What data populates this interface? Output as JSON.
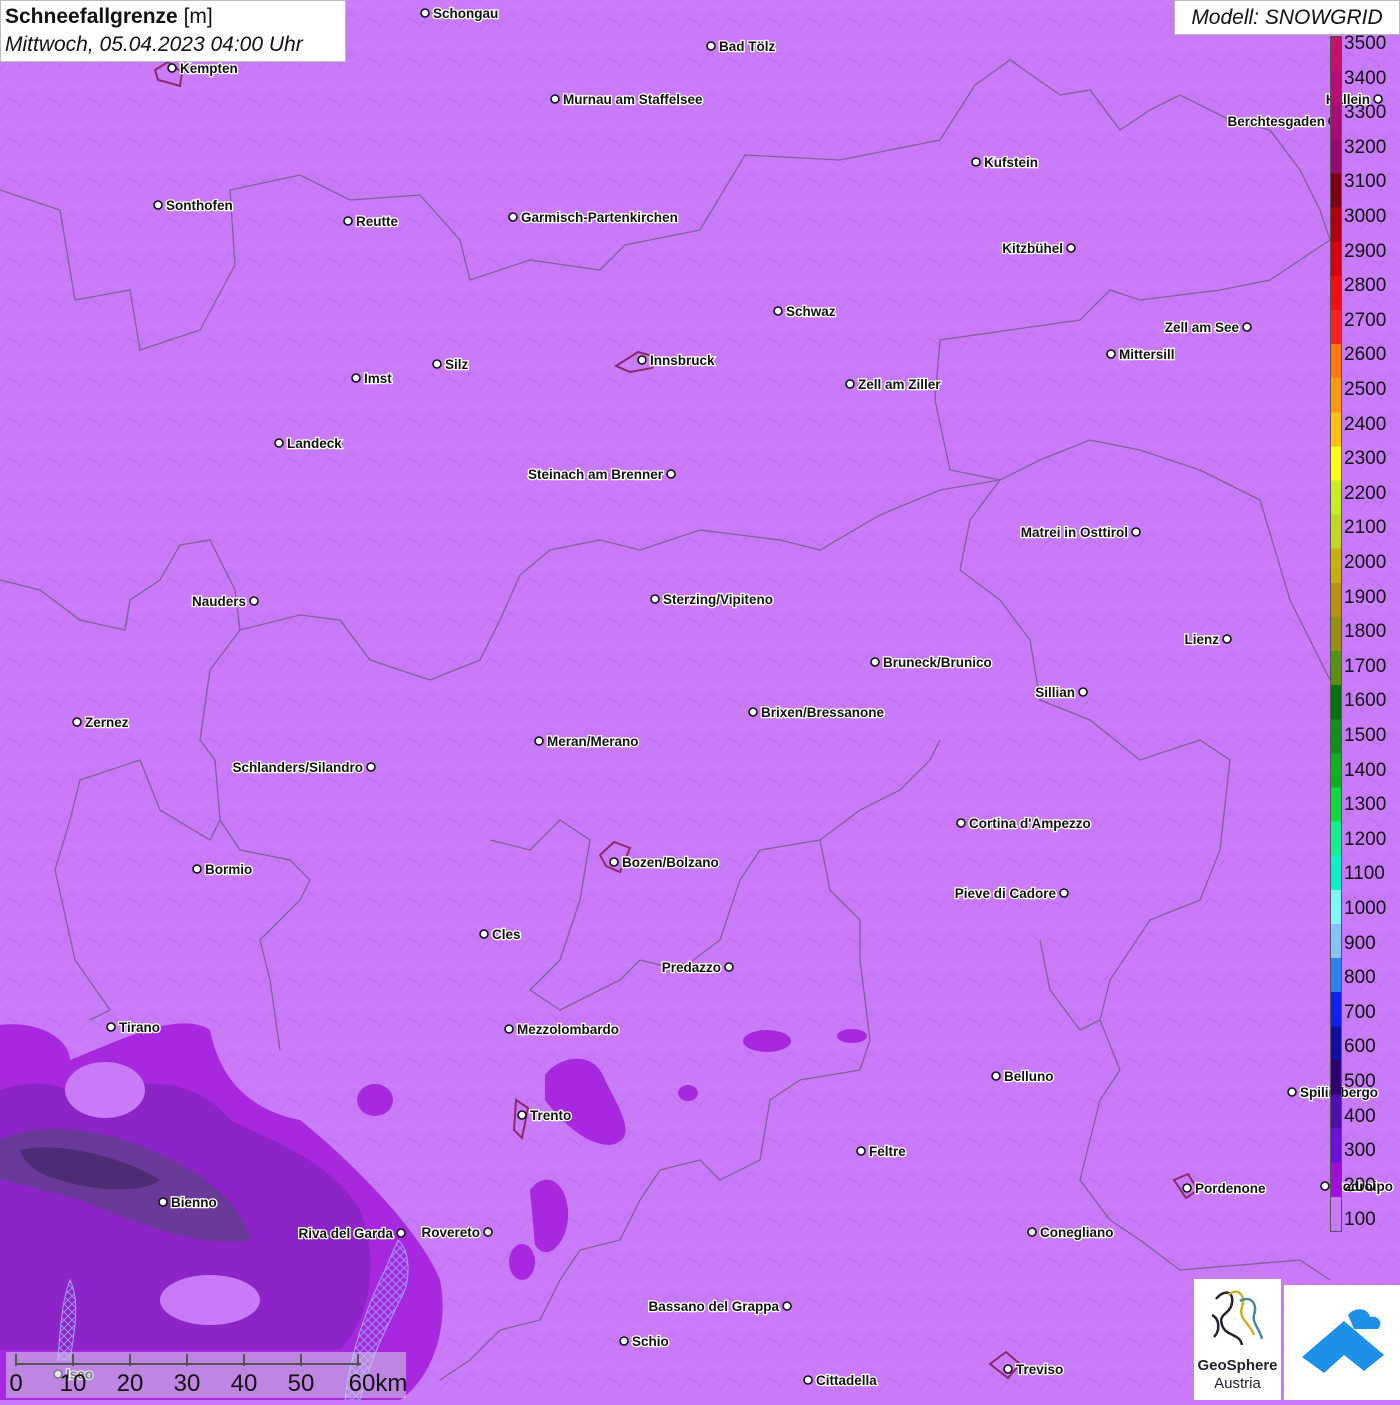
{
  "title": {
    "name": "Schneefallgrenze",
    "unit": "[m]",
    "datetime": "Mittwoch, 05.04.2023 04:00 Uhr"
  },
  "model": "Modell: SNOWGRID",
  "legend": {
    "levels": [
      {
        "value": "3500",
        "color": "#c8106e"
      },
      {
        "value": "3400",
        "color": "#b80e72"
      },
      {
        "value": "3300",
        "color": "#a80c76"
      },
      {
        "value": "3200",
        "color": "#960a6a"
      },
      {
        "value": "3100",
        "color": "#7a0010"
      },
      {
        "value": "3000",
        "color": "#b00010"
      },
      {
        "value": "2900",
        "color": "#d80010"
      },
      {
        "value": "2800",
        "color": "#f01010"
      },
      {
        "value": "2700",
        "color": "#ff2020"
      },
      {
        "value": "2600",
        "color": "#ff7a10"
      },
      {
        "value": "2500",
        "color": "#ff9a10"
      },
      {
        "value": "2400",
        "color": "#ffc010"
      },
      {
        "value": "2300",
        "color": "#ffff10"
      },
      {
        "value": "2200",
        "color": "#c8f020"
      },
      {
        "value": "2100",
        "color": "#c0d820"
      },
      {
        "value": "2000",
        "color": "#c8b010"
      },
      {
        "value": "1900",
        "color": "#b89010"
      },
      {
        "value": "1800",
        "color": "#989010"
      },
      {
        "value": "1700",
        "color": "#589010"
      },
      {
        "value": "1600",
        "color": "#087010"
      },
      {
        "value": "1500",
        "color": "#109020"
      },
      {
        "value": "1400",
        "color": "#10b020"
      },
      {
        "value": "1300",
        "color": "#10d840"
      },
      {
        "value": "1200",
        "color": "#10f090"
      },
      {
        "value": "1100",
        "color": "#10f0c8"
      },
      {
        "value": "1000",
        "color": "#80f8f8"
      },
      {
        "value": "900",
        "color": "#88c0f8"
      },
      {
        "value": "800",
        "color": "#3080f0"
      },
      {
        "value": "700",
        "color": "#1020f0"
      },
      {
        "value": "600",
        "color": "#1010a0"
      },
      {
        "value": "500",
        "color": "#300070"
      },
      {
        "value": "400",
        "color": "#5010b0"
      },
      {
        "value": "300",
        "color": "#7010e0"
      },
      {
        "value": "200",
        "color": "#a010d8"
      },
      {
        "value": "100",
        "color": "#c87af8"
      }
    ]
  },
  "scale": {
    "labels": [
      "0",
      "10",
      "20",
      "30",
      "40",
      "50",
      "60km"
    ]
  },
  "logo": {
    "name": "GeoSphere",
    "sub": "Austria"
  },
  "places": [
    {
      "name": "Schongau",
      "side": "right"
    },
    {
      "name": "Bad Tölz",
      "side": "right"
    },
    {
      "name": "Kempten",
      "side": "right"
    },
    {
      "name": "Murnau am Staffelsee",
      "side": "right"
    },
    {
      "name": "Hallein",
      "side": "left"
    },
    {
      "name": "Berchtesgaden",
      "side": "left"
    },
    {
      "name": "Kufstein",
      "side": "right"
    },
    {
      "name": "Sonthofen",
      "side": "right"
    },
    {
      "name": "Reutte",
      "side": "right"
    },
    {
      "name": "Garmisch-Partenkirchen",
      "side": "right"
    },
    {
      "name": "Kitzbühel",
      "side": "left"
    },
    {
      "name": "Schwaz",
      "side": "right"
    },
    {
      "name": "Zell am See",
      "side": "left"
    },
    {
      "name": "Innsbruck",
      "side": "right"
    },
    {
      "name": "Mittersill",
      "side": "right"
    },
    {
      "name": "Imst",
      "side": "right"
    },
    {
      "name": "Silz",
      "side": "right"
    },
    {
      "name": "Zell am Ziller",
      "side": "right"
    },
    {
      "name": "Landeck",
      "side": "right"
    },
    {
      "name": "Steinach am Brenner",
      "side": "left"
    },
    {
      "name": "Matrei in Osttirol",
      "side": "left"
    },
    {
      "name": "Nauders",
      "side": "left"
    },
    {
      "name": "Sterzing/Vipiteno",
      "side": "right"
    },
    {
      "name": "Lienz",
      "side": "left"
    },
    {
      "name": "Bruneck/Brunico",
      "side": "right"
    },
    {
      "name": "Sillian",
      "side": "left"
    },
    {
      "name": "Zernez",
      "side": "right"
    },
    {
      "name": "Brixen/Bressanone",
      "side": "right"
    },
    {
      "name": "Meran/Merano",
      "side": "right"
    },
    {
      "name": "Schlanders/Silandro",
      "side": "left"
    },
    {
      "name": "Cortina d'Ampezzo",
      "side": "right"
    },
    {
      "name": "Bormio",
      "side": "right"
    },
    {
      "name": "Bozen/Bolzano",
      "side": "right"
    },
    {
      "name": "Pieve di Cadore",
      "side": "left"
    },
    {
      "name": "Cles",
      "side": "right"
    },
    {
      "name": "Predazzo",
      "side": "left"
    },
    {
      "name": "Tirano",
      "side": "right"
    },
    {
      "name": "Mezzolombardo",
      "side": "right"
    },
    {
      "name": "Belluno",
      "side": "right"
    },
    {
      "name": "Spilimbergo",
      "side": "right"
    },
    {
      "name": "Trento",
      "side": "right"
    },
    {
      "name": "Feltre",
      "side": "right"
    },
    {
      "name": "Bienno",
      "side": "right"
    },
    {
      "name": "Pordenone",
      "side": "right"
    },
    {
      "name": "Codroipo",
      "side": "right"
    },
    {
      "name": "Riva del Garda",
      "side": "left"
    },
    {
      "name": "Rovereto",
      "side": "left"
    },
    {
      "name": "Conegliano",
      "side": "right"
    },
    {
      "name": "Bassano del Grappa",
      "side": "left"
    },
    {
      "name": "Schio",
      "side": "right"
    },
    {
      "name": "Iseo",
      "side": "right"
    },
    {
      "name": "Treviso",
      "side": "right"
    },
    {
      "name": "Cittadella",
      "side": "right"
    }
  ]
}
